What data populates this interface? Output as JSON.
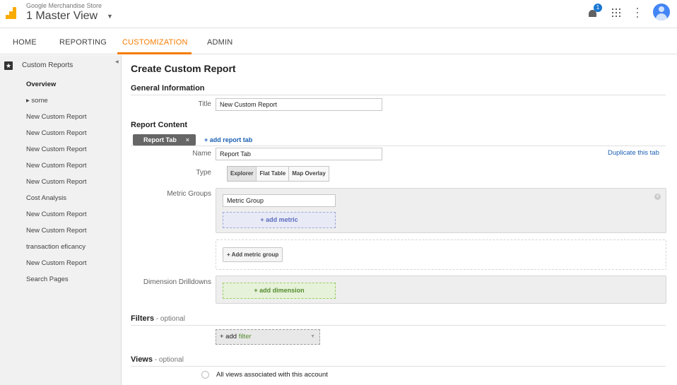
{
  "header": {
    "account_name": "Google Merchandise Store",
    "view_name": "1 Master View",
    "notification_count": "1",
    "icons": [
      "analytics-logo-icon",
      "chevron-down-icon",
      "bell-icon",
      "apps-grid-icon",
      "more-vert-icon",
      "account-avatar-icon"
    ]
  },
  "nav_tabs": [
    "HOME",
    "REPORTING",
    "CUSTOMIZATION",
    "ADMIN"
  ],
  "nav_active": "CUSTOMIZATION",
  "colors": {
    "accent": "#f57c00",
    "link": "#1a5fb4",
    "logo": "#f9ab00"
  },
  "sidebar": {
    "title": "Custom Reports",
    "items": [
      {
        "label": "Overview"
      },
      {
        "label": "▸ some"
      },
      {
        "label": "New Custom Report"
      },
      {
        "label": "New Custom Report"
      },
      {
        "label": "New Custom Report"
      },
      {
        "label": "New Custom Report"
      },
      {
        "label": "New Custom Report"
      },
      {
        "label": "Cost Analysis"
      },
      {
        "label": "New Custom Report"
      },
      {
        "label": "New Custom Report"
      },
      {
        "label": "transaction eficancy"
      },
      {
        "label": "New Custom Report"
      },
      {
        "label": "Search Pages"
      }
    ]
  },
  "main": {
    "page_title": "Create Custom Report",
    "general_info": {
      "heading": "General Information",
      "title_label": "Title",
      "title_value": "New Custom Report"
    },
    "report_content": {
      "heading": "Report Content",
      "tab_label": "Report Tab",
      "tab_close": "×",
      "add_tab_link": "+ add report tab",
      "name_label": "Name",
      "name_value": "Report Tab",
      "duplicate_link": "Duplicate this tab",
      "type_label": "Type",
      "types": [
        "Explorer",
        "Flat Table",
        "Map Overlay"
      ],
      "type_selected": "Explorer",
      "metric_groups_label": "Metric Groups",
      "metric_group_value": "Metric Group",
      "add_metric": "+ add metric",
      "add_metric_group": "+ Add metric group",
      "dimension_label": "Dimension Drilldowns",
      "add_dimension": "+ add dimension"
    },
    "filters": {
      "heading": "Filters",
      "optional": " - optional",
      "add_prefix": "+ add ",
      "add_word": "filter"
    },
    "views": {
      "heading": "Views",
      "optional": " - optional",
      "option_all": "All views associated with this account"
    }
  }
}
